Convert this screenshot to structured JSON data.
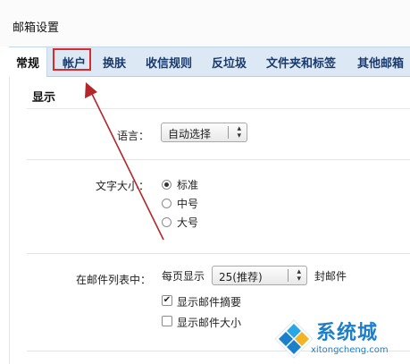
{
  "header": {
    "title": "邮箱设置"
  },
  "tabs": [
    {
      "label": "常规",
      "active": true
    },
    {
      "label": "帐户",
      "active": false
    },
    {
      "label": "换肤",
      "active": false
    },
    {
      "label": "收信规则",
      "active": false
    },
    {
      "label": "反垃圾",
      "active": false
    },
    {
      "label": "文件夹和标签",
      "active": false
    },
    {
      "label": "其他邮箱",
      "active": false
    }
  ],
  "section": {
    "title": "显示"
  },
  "language": {
    "label": "语言：",
    "selected": "自动选择"
  },
  "font_size": {
    "label": "文字大小：",
    "options": [
      {
        "label": "标准",
        "checked": true
      },
      {
        "label": "中号",
        "checked": false
      },
      {
        "label": "大号",
        "checked": false
      }
    ]
  },
  "mail_list": {
    "label": "在邮件列表中：",
    "per_page_prefix": "每页显示",
    "per_page_selected": "25(推荐)",
    "per_page_suffix": "封邮件",
    "checkboxes": [
      {
        "label": "显示邮件摘要",
        "checked": true
      },
      {
        "label": "显示邮件大小",
        "checked": false
      }
    ]
  },
  "watermark": {
    "name": "系统城",
    "site": "xitongcheng.com"
  },
  "colors": {
    "tab_bar": "#dce8f4",
    "tab_text": "#1a3a6c",
    "annotation_red": "#d92b2b",
    "watermark_blue": "#1c7fc9"
  }
}
